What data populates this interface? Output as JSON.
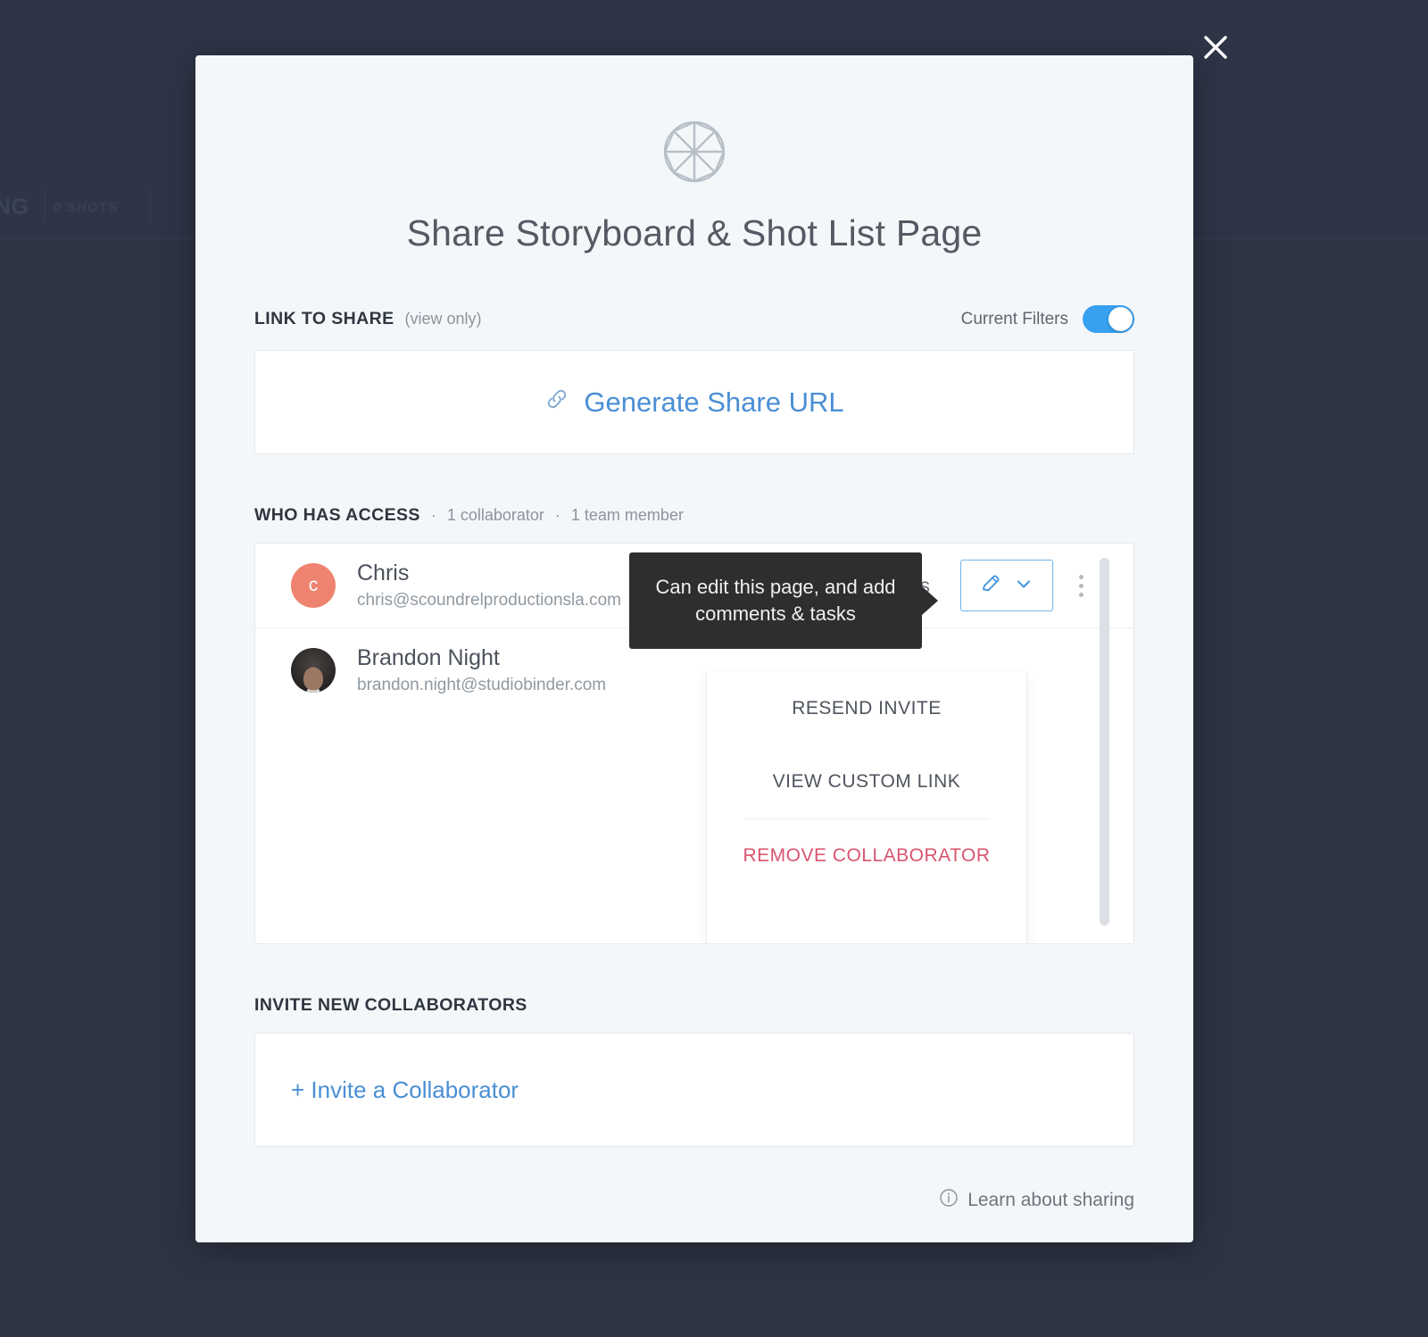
{
  "background": {
    "breadcrumb_fragment": "NG",
    "shots_count_label": "0 SHOTS"
  },
  "modal": {
    "logo_icon": "aperture-icon",
    "title": "Share Storyboard & Shot List Page",
    "close_icon": "close-icon",
    "link_section": {
      "label": "LINK TO SHARE",
      "sub_label": "(view only)",
      "filters_label": "Current Filters",
      "filters_toggle_state": "on",
      "generate_icon": "link-icon",
      "generate_label": "Generate Share URL"
    },
    "access_section": {
      "label": "WHO HAS ACCESS",
      "separator": "·",
      "collaborator_count": "1 collaborator",
      "team_member_count": "1 team member",
      "rows": [
        {
          "avatar_type": "initial",
          "avatar_initial": "c",
          "avatar_color": "#ee8370",
          "name": "Chris",
          "email": "chris@scoundrelproductionsla.com",
          "views": "0 views",
          "permission_icon": "pencil-icon",
          "dropdown_icon": "chevron-down-icon",
          "kebab_icon": "kebab-menu-icon"
        },
        {
          "avatar_type": "photo",
          "avatar_initial": "",
          "name": "Brandon Night",
          "email": "brandon.night@studiobinder.com",
          "views": "",
          "permission_icon": "",
          "dropdown_icon": "",
          "kebab_icon": ""
        }
      ],
      "dropdown_menu": {
        "items": [
          {
            "label": "RESEND INVITE",
            "style": "normal"
          },
          {
            "label": "VIEW CUSTOM LINK",
            "style": "normal"
          },
          {
            "label": "REMOVE COLLABORATOR",
            "style": "danger"
          }
        ]
      },
      "tooltip_text": "Can edit this page, and add comments & tasks"
    },
    "invite_section": {
      "label": "INVITE NEW COLLABORATORS",
      "invite_label": "+ Invite a Collaborator"
    },
    "footer": {
      "info_icon": "info-circle-icon",
      "learn_label": "Learn about sharing"
    }
  },
  "colors": {
    "accent_blue": "#4a8fd4",
    "toggle_blue": "#38a0f0",
    "danger_red": "#d9546f",
    "avatar_coral": "#ee8370",
    "backdrop": "#2d3443",
    "modal_bg": "#f4f7fa"
  }
}
